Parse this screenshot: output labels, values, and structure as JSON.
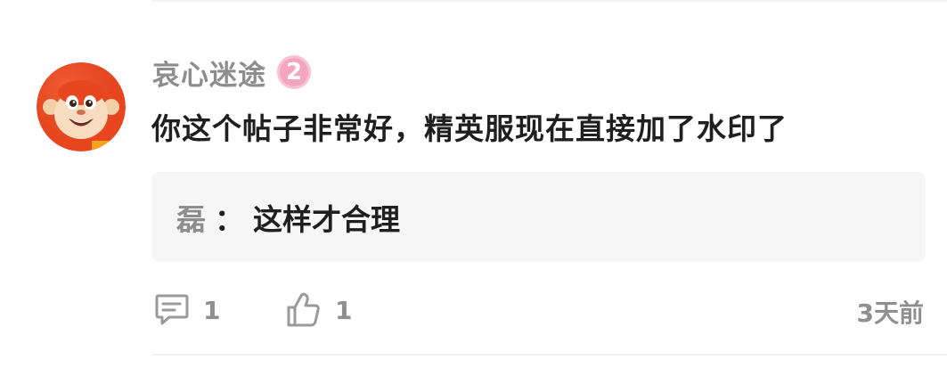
{
  "comment": {
    "username": "哀心迷途",
    "level": "2",
    "text": "你这个帖子非常好，精英服现在直接加了水印了",
    "reply": {
      "author": "磊",
      "separator": "：",
      "text": "这样才合理"
    },
    "actions": {
      "reply_icon": "comment-icon",
      "reply_count": "1",
      "like_icon": "thumbs-up-icon",
      "like_count": "1"
    },
    "time": "3天前"
  },
  "colors": {
    "username": "#8d8d8d",
    "badge": "#f4a6bf",
    "reply_bg": "#f6f6f6",
    "icon": "#9a9a9a",
    "avatar": "#e8461f"
  }
}
